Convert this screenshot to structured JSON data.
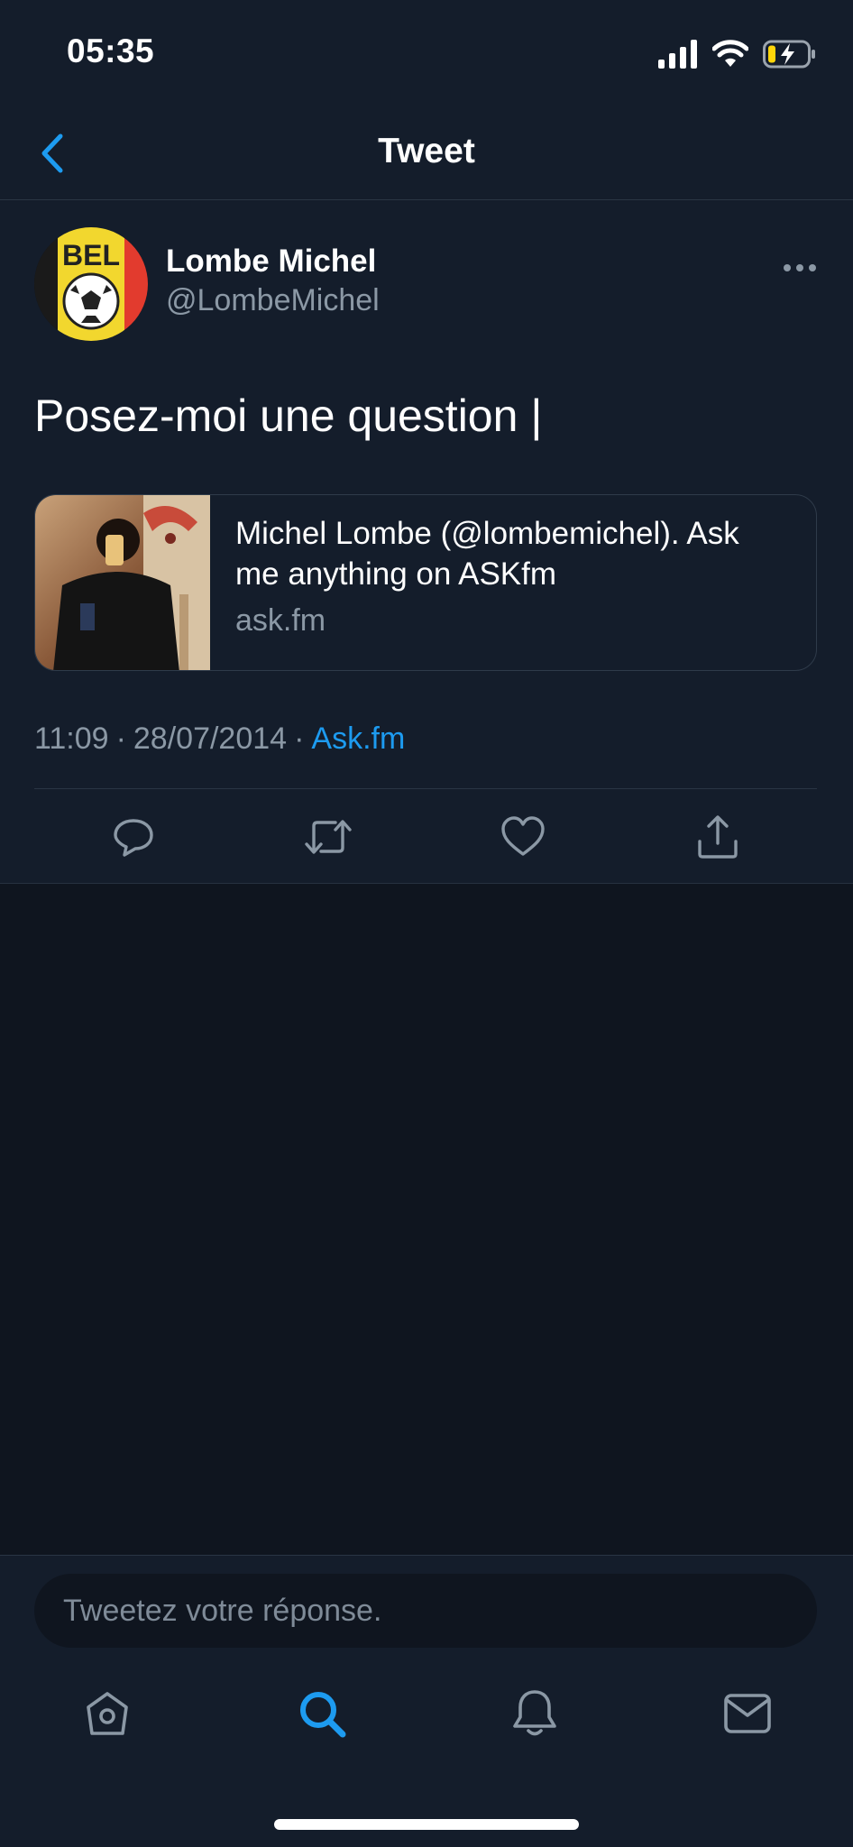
{
  "status_bar": {
    "time": "05:35"
  },
  "header": {
    "title": "Tweet"
  },
  "tweet": {
    "author": {
      "name": "Lombe Michel",
      "handle": "@LombeMichel",
      "avatar_text": "BEL"
    },
    "text": "Posez-moi une question |",
    "card": {
      "title": "Michel Lombe (@lombemichel). Ask me anything on ASKfm",
      "domain": "ask.fm"
    },
    "time": "11:09",
    "date": "28/07/2014",
    "separator": "·",
    "source": "Ask.fm"
  },
  "actions": [
    "reply-icon",
    "retweet-icon",
    "like-icon",
    "share-icon"
  ],
  "reply": {
    "placeholder": "Tweetez votre réponse."
  },
  "tabs": {
    "items": [
      "home-icon",
      "search-icon",
      "notifications-icon",
      "messages-icon"
    ],
    "active": "search-icon"
  },
  "colors": {
    "background": "#141d2b",
    "accent": "#1d9bf0",
    "secondary_text": "#8b98a5"
  }
}
